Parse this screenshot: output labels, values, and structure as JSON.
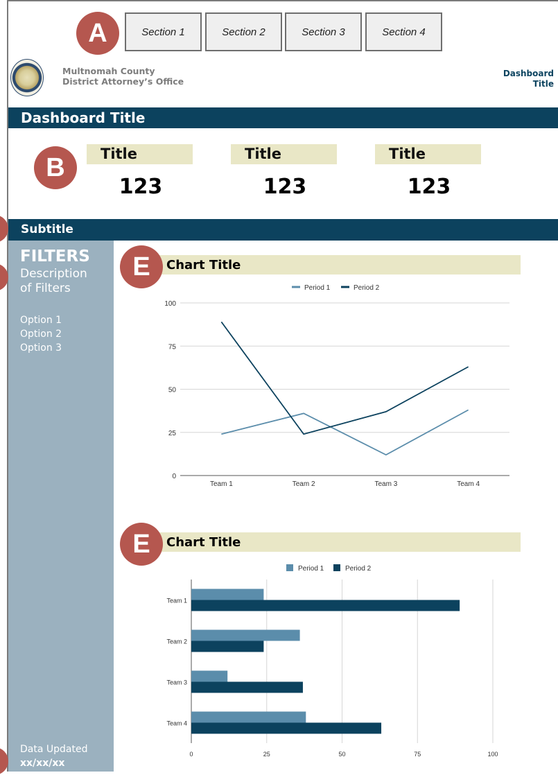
{
  "markers": {
    "a": "A",
    "b": "B",
    "e1": "E",
    "e2": "E"
  },
  "tabs": [
    "Section 1",
    "Section 2",
    "Section 3",
    "Section 4"
  ],
  "org": {
    "line1": "Multnomah County",
    "line2": "District Attorney’s Office"
  },
  "header_mini": {
    "line1": "Dashboard",
    "line2": "Title"
  },
  "dashboard_title": "Dashboard Title",
  "kpis": [
    {
      "title": "Title",
      "value": "123"
    },
    {
      "title": "Title",
      "value": "123"
    },
    {
      "title": "Title",
      "value": "123"
    }
  ],
  "subtitle": "Subtitle",
  "sidebar": {
    "heading": "FILTERS",
    "desc1": "Description",
    "desc2": "of Filters",
    "options": [
      "Option 1",
      "Option 2",
      "Option 3"
    ],
    "updated_label": "Data Updated",
    "updated_value": "xx/xx/xx"
  },
  "colors": {
    "period1": "#5b8dab",
    "period2": "#0c425e",
    "accent_bar": "#0c425e",
    "title_bg": "#e9e7c6",
    "badge": "#b5574f"
  },
  "chart_data": [
    {
      "type": "line",
      "title": "Chart Title",
      "categories": [
        "Team 1",
        "Team 2",
        "Team 3",
        "Team 4"
      ],
      "series": [
        {
          "name": "Period 1",
          "values": [
            24,
            36,
            12,
            38
          ]
        },
        {
          "name": "Period 2",
          "values": [
            89,
            24,
            37,
            63
          ]
        }
      ],
      "ylim": [
        0,
        100
      ],
      "yticks": [
        0,
        25,
        50,
        75,
        100
      ],
      "legend": "top",
      "grid": true
    },
    {
      "type": "bar",
      "orientation": "horizontal",
      "title": "Chart Title",
      "categories": [
        "Team 1",
        "Team 2",
        "Team 3",
        "Team 4"
      ],
      "series": [
        {
          "name": "Period 1",
          "values": [
            24,
            36,
            12,
            38
          ]
        },
        {
          "name": "Period 2",
          "values": [
            89,
            24,
            37,
            63
          ]
        }
      ],
      "xlim": [
        0,
        100
      ],
      "xticks": [
        0,
        25,
        50,
        75,
        100
      ],
      "legend": "top",
      "grid": true
    }
  ]
}
